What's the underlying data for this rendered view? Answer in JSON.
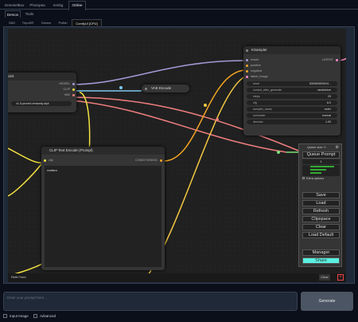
{
  "top_tabs": [
    "GreenielBox",
    "Photopea",
    "rembg",
    "Online"
  ],
  "sub_tabs": [
    "Demos",
    "Tools"
  ],
  "ui_tabs": [
    "SAD",
    "TripoSR",
    "Dream",
    "Polish",
    "ComfyUI [CPU]"
  ],
  "nodes": {
    "checkpoint": {
      "title": "oint",
      "slots_out": [
        "MODEL",
        "CLIP",
        "VAE"
      ],
      "ckpt_name": "v1-5-pruned-emaonly.ckpt"
    },
    "vae_encode": {
      "title": "VAE Encode"
    },
    "clip_text": {
      "title": "CLIP Text Encode (Prompt)",
      "slot_in": "clip",
      "slot_out": "CONDITIONING",
      "text": "realism"
    },
    "ksampler": {
      "title": "KSampler",
      "inputs": [
        "model",
        "positive",
        "negative",
        "latent_image"
      ],
      "output": "LATENT",
      "widgets": [
        {
          "name": "seed",
          "value": "830062809034..."
        },
        {
          "name": "control_after_generate",
          "value": "randomize"
        },
        {
          "name": "steps",
          "value": "20"
        },
        {
          "name": "cfg",
          "value": "8.0"
        },
        {
          "name": "sampler_name",
          "value": "euler"
        },
        {
          "name": "scheduler",
          "value": "normal"
        },
        {
          "name": "denoise",
          "value": "1.00"
        }
      ]
    }
  },
  "queue_panel": {
    "queue_size": "Queue size: 0",
    "queue_prompt": "Queue Prompt",
    "batch_count": "1",
    "extra_options": "Extra options",
    "buttons": [
      "Save",
      "Load",
      "Refresh",
      "Clipspace",
      "Clear",
      "Load Default",
      "Manager",
      "Share"
    ],
    "accent_color": "#59f0e0"
  },
  "canvas_bottom": {
    "left": "Refit Feed",
    "right": "Clear"
  },
  "prompt": {
    "placeholder": "Enter your prompt here..."
  },
  "generate_label": "Generate",
  "checkboxes": [
    "Input Image",
    "Advanced"
  ]
}
